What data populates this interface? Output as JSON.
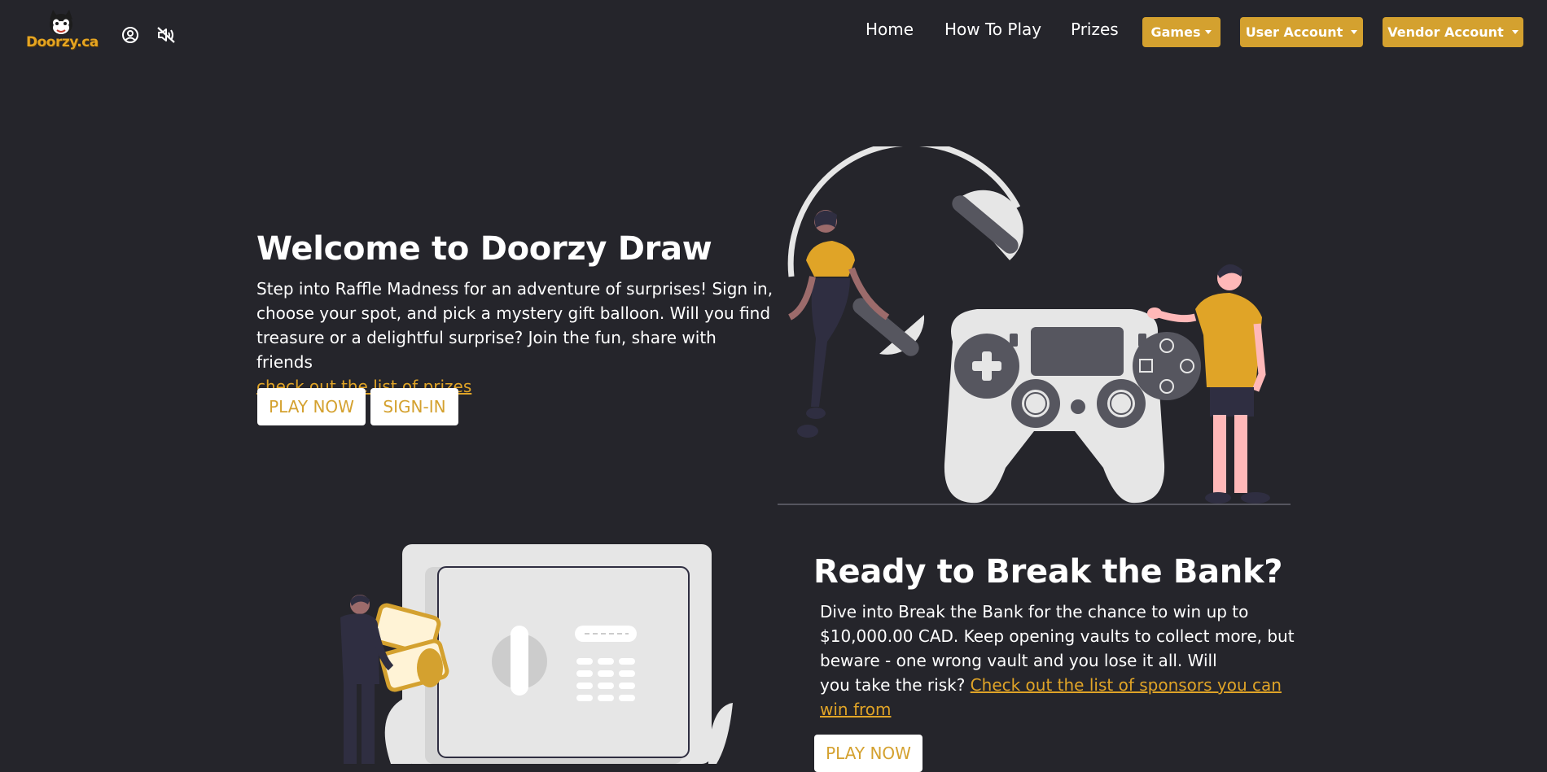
{
  "brand": {
    "logo_text": "Doorzy.ca"
  },
  "nav": {
    "links": [
      "Home",
      "How To Play",
      "Prizes"
    ],
    "dropdowns": [
      "Games",
      "User Account",
      "Vendor Account"
    ]
  },
  "hero": {
    "title": "Welcome to Doorzy Draw",
    "text_lines": [
      "Step into Raffle Madness for an adventure of surprises! Sign in,",
      "choose your spot, and pick a mystery gift balloon. Will you find",
      "treasure or a delightful surprise? Join the fun, share with friends"
    ],
    "link": "check out the list of prizes",
    "play_label": "PLAY NOW",
    "signin_label": "SIGN-IN"
  },
  "bank": {
    "title": "Ready to Break the Bank?",
    "text_lines": [
      "Dive into Break the Bank for the chance to win up to",
      "$10,000.00 CAD. Keep opening vaults to collect more, but",
      "beware - one wrong vault and you lose it all. Will",
      "you take the risk?"
    ],
    "link_line1": "Check out the list of sponsors you can",
    "link_line2": "win from",
    "play_label": "PLAY NOW"
  },
  "colors": {
    "background": "#25252b",
    "accent": "#d4a12f",
    "link": "#e0a427"
  },
  "icons": [
    "user-circle-icon",
    "sound-off-icon",
    "caret-down-icon"
  ]
}
